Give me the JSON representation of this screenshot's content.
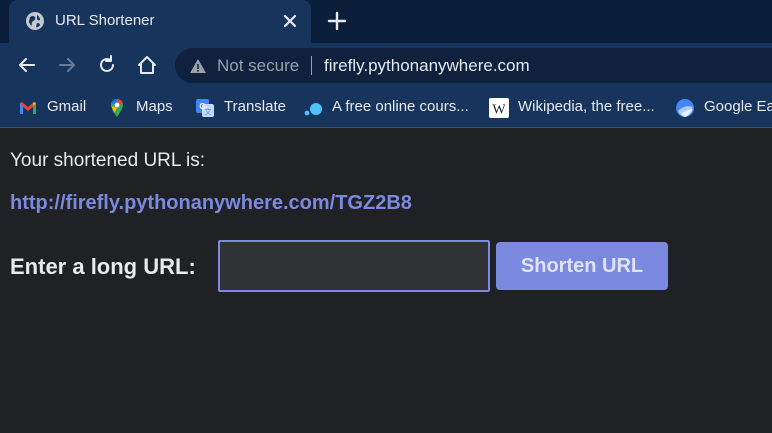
{
  "tab": {
    "title": "URL Shortener",
    "favicon": "globe-icon"
  },
  "omnibox": {
    "security_label": "Not secure",
    "url": "firefly.pythonanywhere.com"
  },
  "bookmarks": [
    {
      "label": "Gmail",
      "icon": "gmail-icon"
    },
    {
      "label": "Maps",
      "icon": "maps-icon"
    },
    {
      "label": "Translate",
      "icon": "translate-icon"
    },
    {
      "label": "A free online cours...",
      "icon": "course-icon"
    },
    {
      "label": "Wikipedia, the free...",
      "icon": "wikipedia-icon"
    },
    {
      "label": "Google Earth",
      "icon": "google-earth-icon"
    }
  ],
  "page": {
    "intro_text": "Your shortened URL is:",
    "short_url": "http://firefly.pythonanywhere.com/TGZ2B8",
    "form_label": "Enter a long URL:",
    "input_value": "",
    "button_label": "Shorten URL"
  },
  "colors": {
    "page_background": "#202124",
    "accent": "#7b8ae0",
    "chrome_frame": "#17345c"
  }
}
